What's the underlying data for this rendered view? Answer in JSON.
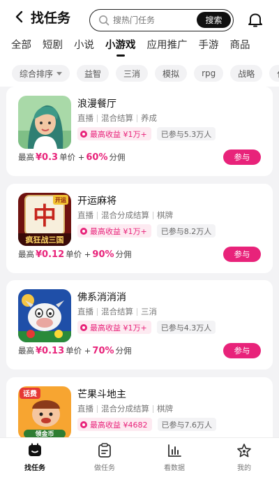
{
  "header": {
    "title": "找任务",
    "search_placeholder": "搜热门任务",
    "search_button": "搜索"
  },
  "tabs": [
    "全部",
    "短剧",
    "小说",
    "小游戏",
    "应用推广",
    "手游",
    "商品"
  ],
  "active_tab": "小游戏",
  "filters": [
    "综合排序",
    "益智",
    "三消",
    "模拟",
    "rpg",
    "战略",
    "休闲"
  ],
  "tasks": [
    {
      "name": "浪漫餐厅",
      "tags": [
        "直播",
        "混合结算",
        "养成"
      ],
      "max_earning": "最高收益 ¥1万+",
      "joined": "已参与5.3万人",
      "price_prefix": "最高",
      "unit_price": "¥0.3",
      "unit_label": "单价 +",
      "share": "60%",
      "share_label": "分佣",
      "join_label": "参与",
      "icon": "girl-portrait-icon"
    },
    {
      "name": "开运麻将",
      "tags": [
        "直播",
        "混合分成结算",
        "棋牌"
      ],
      "max_earning": "最高收益 ¥1万+",
      "joined": "已参与8.2万人",
      "price_prefix": "最高",
      "unit_price": "¥0.12",
      "unit_label": "单价 +",
      "share": "90%",
      "share_label": "分佣",
      "join_label": "参与",
      "icon": "mahjong-tile-icon",
      "icon_text": "疯狂战三国",
      "icon_glyph": "中",
      "icon_corner": "开运"
    },
    {
      "name": "佛系消消消",
      "tags": [
        "直播",
        "混合结算",
        "三消"
      ],
      "max_earning": "最高收益 ¥1万+",
      "joined": "已参与4.3万人",
      "price_prefix": "最高",
      "unit_price": "¥0.13",
      "unit_label": "单价 +",
      "share": "70%",
      "share_label": "分佣",
      "join_label": "参与",
      "icon": "cow-character-icon"
    },
    {
      "name": "芒果斗地主",
      "tags": [
        "直播",
        "混合分成结算",
        "棋牌"
      ],
      "max_earning": "最高收益 ¥4682",
      "joined": "已参与7.6万人",
      "price_prefix": "",
      "unit_price": "",
      "unit_label": "",
      "share": "",
      "share_label": "",
      "join_label": "",
      "icon": "landlord-character-icon",
      "icon_text": "领金币",
      "icon_corner": "话费"
    }
  ],
  "bottom_nav": [
    {
      "label": "找任务",
      "icon": "home-icon",
      "active": true
    },
    {
      "label": "做任务",
      "icon": "clipboard-icon",
      "active": false
    },
    {
      "label": "看数据",
      "icon": "bar-chart-icon",
      "active": false
    },
    {
      "label": "我的",
      "icon": "star-icon",
      "active": false
    }
  ],
  "colors": {
    "accent": "#e8237a",
    "accent_light": "#fdeaf1"
  }
}
